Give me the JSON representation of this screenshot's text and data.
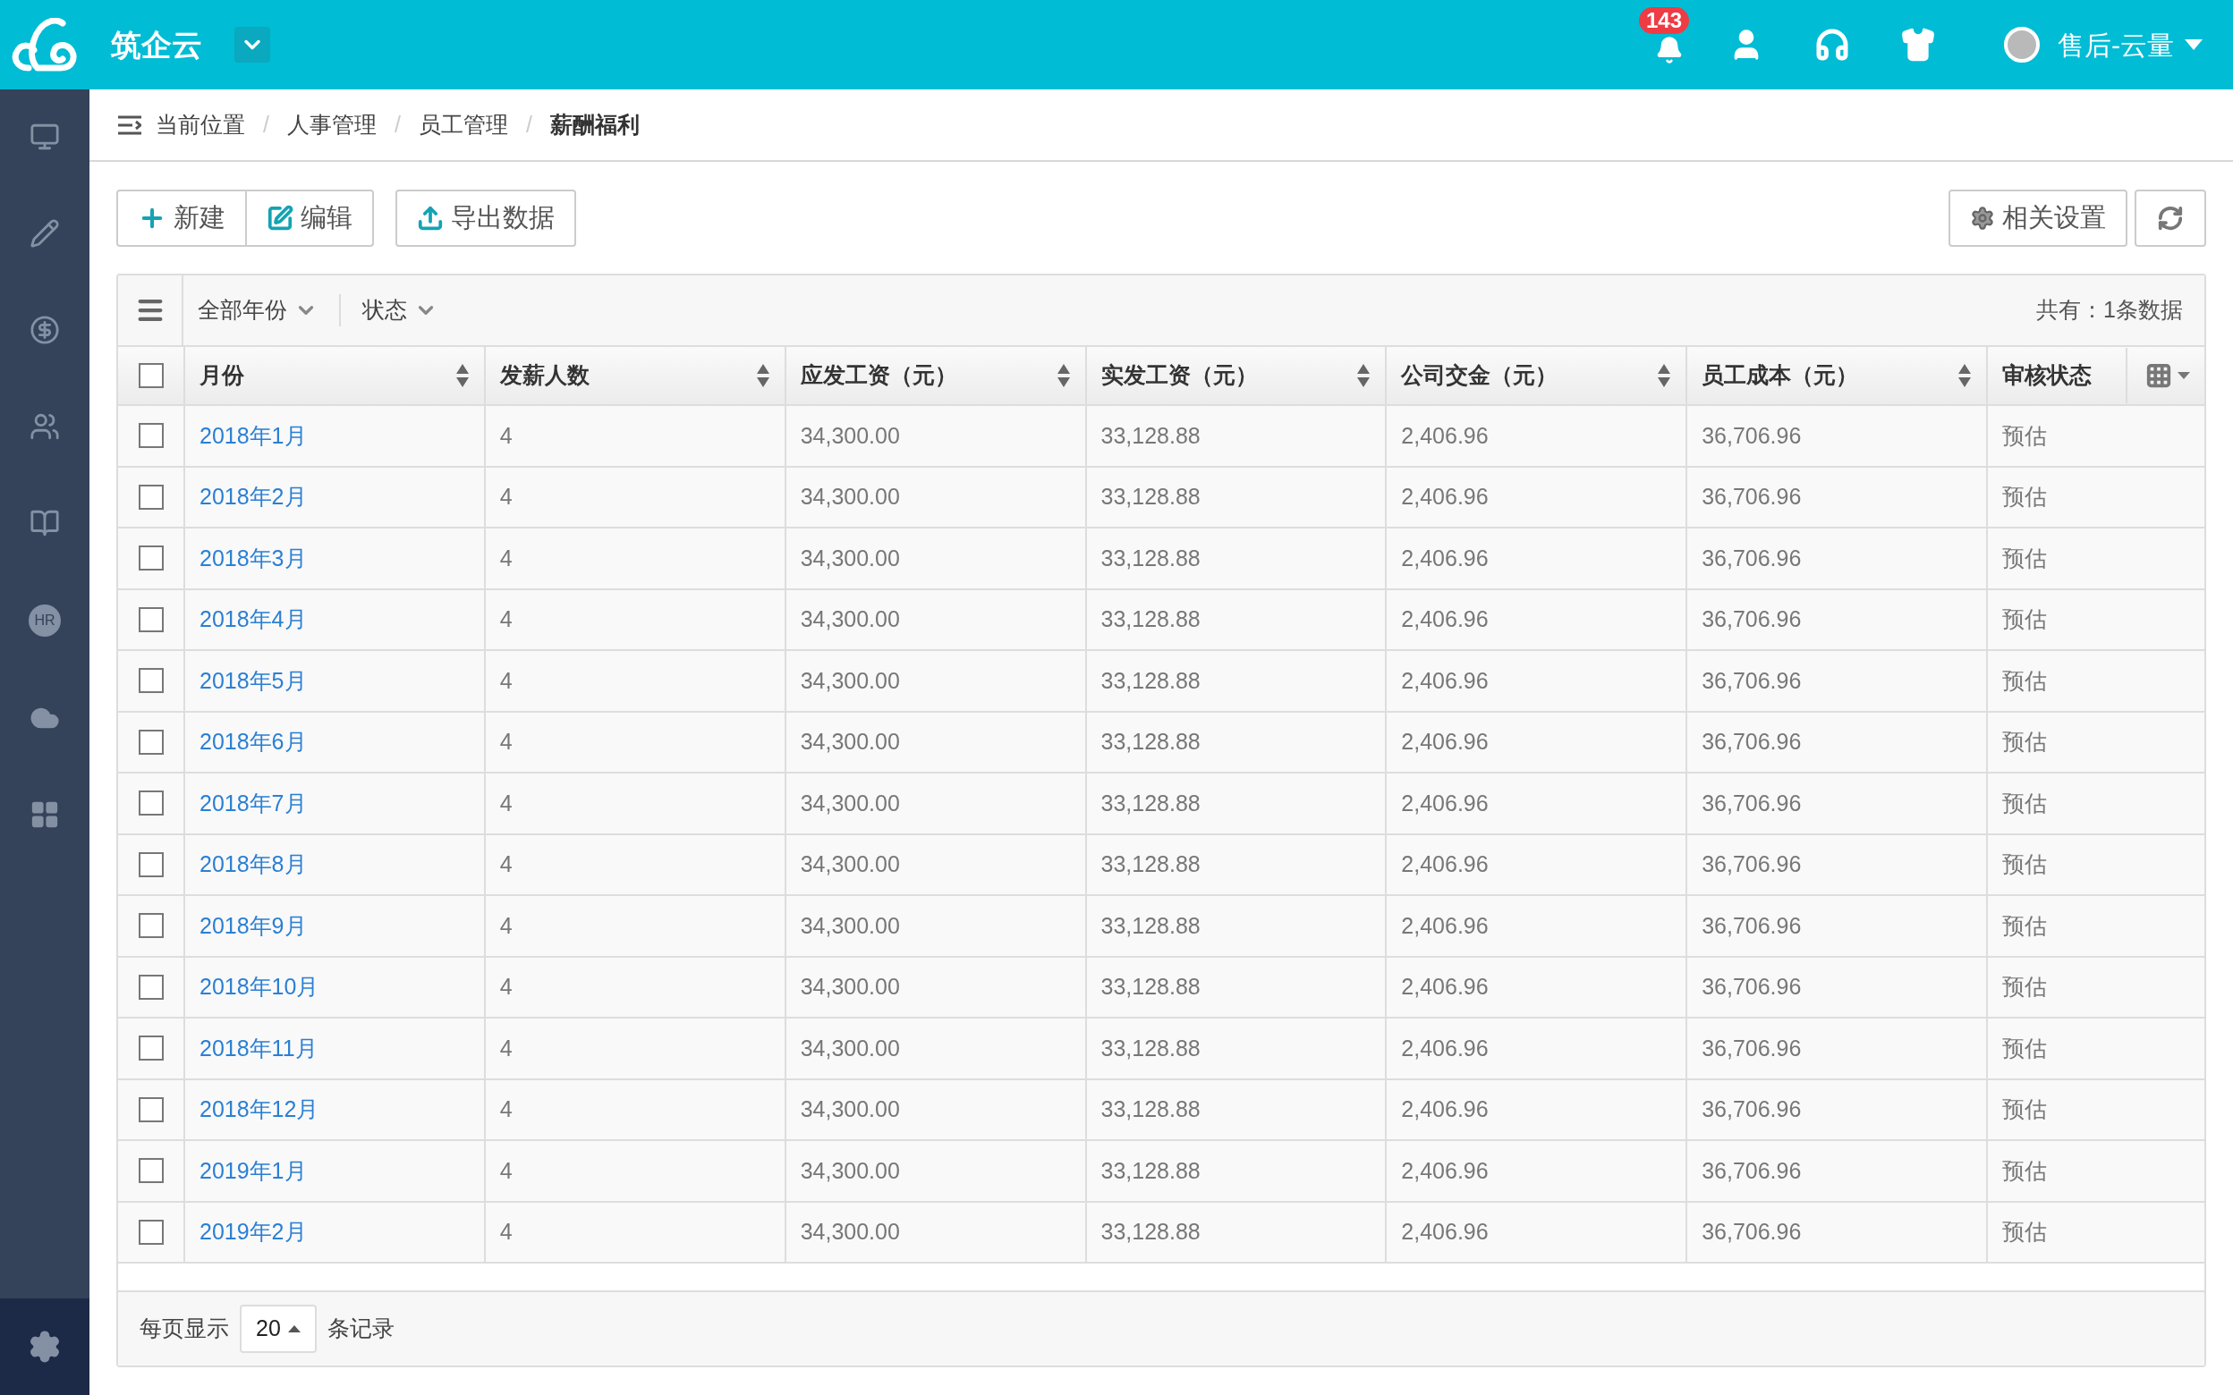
{
  "top_bar": {
    "brand": "筑企云",
    "notifications": "143",
    "user": "售后-云量"
  },
  "sidebar": {
    "items": [
      {
        "kind": "monitor"
      },
      {
        "kind": "pencil"
      },
      {
        "kind": "moneybag"
      },
      {
        "kind": "users"
      },
      {
        "kind": "book"
      },
      {
        "kind": "badge",
        "text": "HR"
      },
      {
        "kind": "cloud"
      },
      {
        "kind": "grid"
      }
    ]
  },
  "breadcrumb": {
    "separator": "/",
    "items": [
      {
        "label": "当前位置",
        "current": false
      },
      {
        "label": "人事管理",
        "current": false
      },
      {
        "label": "员工管理",
        "current": false
      },
      {
        "label": "薪酬福利",
        "current": true
      }
    ]
  },
  "toolbar": {
    "left": [
      {
        "kind": "plus",
        "label": "新建"
      },
      {
        "kind": "edit",
        "label": "编辑"
      },
      {
        "kind": "export",
        "label": "导出数据"
      }
    ],
    "settings": "相关设置"
  },
  "filters": [
    {
      "label": "全部年份"
    },
    {
      "label": "状态"
    }
  ],
  "total": "共有：1条数据",
  "table": {
    "columns": [
      {
        "label": "月份",
        "sortable": true
      },
      {
        "label": "发薪人数",
        "sortable": true
      },
      {
        "label": "应发工资（元）",
        "sortable": true
      },
      {
        "label": "实发工资（元）",
        "sortable": true
      },
      {
        "label": "公司交金（元）",
        "sortable": true
      },
      {
        "label": "员工成本（元）",
        "sortable": true
      },
      {
        "label": "审核状态",
        "sortable": false
      }
    ],
    "header_checked": false,
    "rows": [
      {
        "checked": false,
        "cells": [
          "2018年1月",
          "4",
          "34,300.00",
          "33,128.88",
          "2,406.96",
          "36,706.96",
          "预估"
        ]
      },
      {
        "checked": false,
        "cells": [
          "2018年2月",
          "4",
          "34,300.00",
          "33,128.88",
          "2,406.96",
          "36,706.96",
          "预估"
        ]
      },
      {
        "checked": false,
        "cells": [
          "2018年3月",
          "4",
          "34,300.00",
          "33,128.88",
          "2,406.96",
          "36,706.96",
          "预估"
        ]
      },
      {
        "checked": false,
        "cells": [
          "2018年4月",
          "4",
          "34,300.00",
          "33,128.88",
          "2,406.96",
          "36,706.96",
          "预估"
        ]
      },
      {
        "checked": false,
        "cells": [
          "2018年5月",
          "4",
          "34,300.00",
          "33,128.88",
          "2,406.96",
          "36,706.96",
          "预估"
        ]
      },
      {
        "checked": false,
        "cells": [
          "2018年6月",
          "4",
          "34,300.00",
          "33,128.88",
          "2,406.96",
          "36,706.96",
          "预估"
        ]
      },
      {
        "checked": false,
        "cells": [
          "2018年7月",
          "4",
          "34,300.00",
          "33,128.88",
          "2,406.96",
          "36,706.96",
          "预估"
        ]
      },
      {
        "checked": false,
        "cells": [
          "2018年8月",
          "4",
          "34,300.00",
          "33,128.88",
          "2,406.96",
          "36,706.96",
          "预估"
        ]
      },
      {
        "checked": false,
        "cells": [
          "2018年9月",
          "4",
          "34,300.00",
          "33,128.88",
          "2,406.96",
          "36,706.96",
          "预估"
        ]
      },
      {
        "checked": false,
        "cells": [
          "2018年10月",
          "4",
          "34,300.00",
          "33,128.88",
          "2,406.96",
          "36,706.96",
          "预估"
        ]
      },
      {
        "checked": false,
        "cells": [
          "2018年11月",
          "4",
          "34,300.00",
          "33,128.88",
          "2,406.96",
          "36,706.96",
          "预估"
        ]
      },
      {
        "checked": false,
        "cells": [
          "2018年12月",
          "4",
          "34,300.00",
          "33,128.88",
          "2,406.96",
          "36,706.96",
          "预估"
        ]
      },
      {
        "checked": false,
        "cells": [
          "2019年1月",
          "4",
          "34,300.00",
          "33,128.88",
          "2,406.96",
          "36,706.96",
          "预估"
        ]
      },
      {
        "checked": false,
        "cells": [
          "2019年2月",
          "4",
          "34,300.00",
          "33,128.88",
          "2,406.96",
          "36,706.96",
          "预估"
        ]
      }
    ]
  },
  "footer": {
    "before": "每页显示",
    "page_size": "20",
    "after": "条记录"
  }
}
